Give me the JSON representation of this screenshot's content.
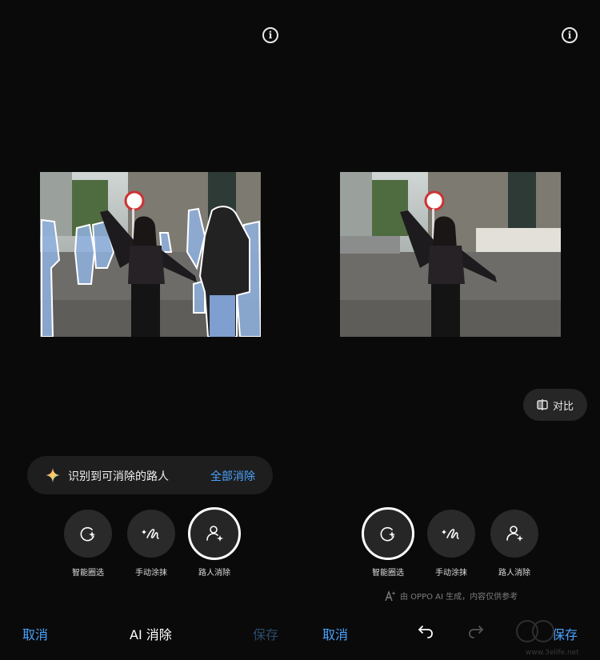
{
  "left": {
    "detect_banner": {
      "text": "识别到可消除的路人",
      "action": "全部消除"
    },
    "tools": [
      {
        "label": "智能圈选",
        "icon": "smart-lasso-icon",
        "active": false
      },
      {
        "label": "手动涂抹",
        "icon": "brush-icon",
        "active": false
      },
      {
        "label": "路人消除",
        "icon": "passerby-remove-icon",
        "active": true
      }
    ],
    "bottom": {
      "cancel": "取消",
      "title": "AI 消除",
      "save": "保存"
    }
  },
  "right": {
    "compare_label": "对比",
    "tools": [
      {
        "label": "智能圈选",
        "icon": "smart-lasso-icon",
        "active": true
      },
      {
        "label": "手动涂抹",
        "icon": "brush-icon",
        "active": false
      },
      {
        "label": "路人消除",
        "icon": "passerby-remove-icon",
        "active": false
      }
    ],
    "disclaimer": "由 OPPO AI 生成，内容仅供参考",
    "bottom": {
      "cancel": "取消",
      "save": "保存"
    }
  },
  "watermark": "www.3elife.net",
  "colors": {
    "accent": "#4aa3ff",
    "background": "#0a0a0a",
    "disabled_save": "#2c4b6c"
  }
}
